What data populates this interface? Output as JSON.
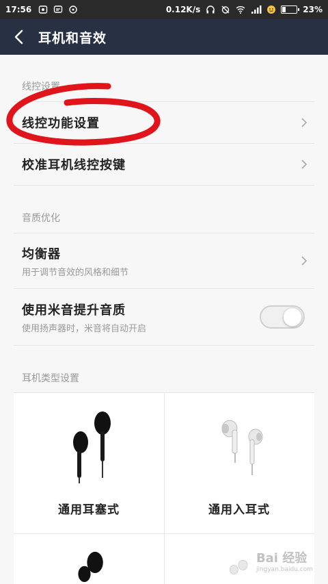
{
  "status_bar": {
    "time": "17:56",
    "net_speed": "0.12K/s",
    "battery": "23%",
    "battery_level": 0.23,
    "icons": [
      "photo-icon",
      "message-icon",
      "notification-icon",
      "headphones-icon",
      "alarm-off-icon",
      "wifi-icon",
      "signal-icon",
      "emoji-icon",
      "battery-icon"
    ]
  },
  "app_bar": {
    "title": "耳机和音效",
    "back_icon": "back-arrow-icon"
  },
  "sections": {
    "line_control": {
      "header": "线控设置",
      "items": [
        {
          "label": "线控功能设置"
        },
        {
          "label": "校准耳机线控按键"
        }
      ]
    },
    "sound_quality": {
      "header": "音质优化",
      "equalizer": {
        "label": "均衡器",
        "sub": "用于调节音效的风格和细节"
      },
      "mic": {
        "label": "使用米音提升音质",
        "sub": "使用扬声器时，米音将自动开启",
        "enabled": false
      }
    },
    "headphone_type": {
      "header": "耳机类型设置",
      "cells": [
        {
          "label": "通用耳塞式",
          "image": "black-earbuds"
        },
        {
          "label": "通用入耳式",
          "image": "white-in-ear"
        },
        {
          "label": "",
          "image": "black-earbuds"
        },
        {
          "label": "",
          "image": "white-in-ear"
        }
      ]
    }
  },
  "watermark": {
    "text": "Bai 经验",
    "sub": "jingyan.baidu.com"
  },
  "colors": {
    "app_bar": "#283144",
    "background": "#f7f7f7",
    "annotation": "#e0141b"
  }
}
